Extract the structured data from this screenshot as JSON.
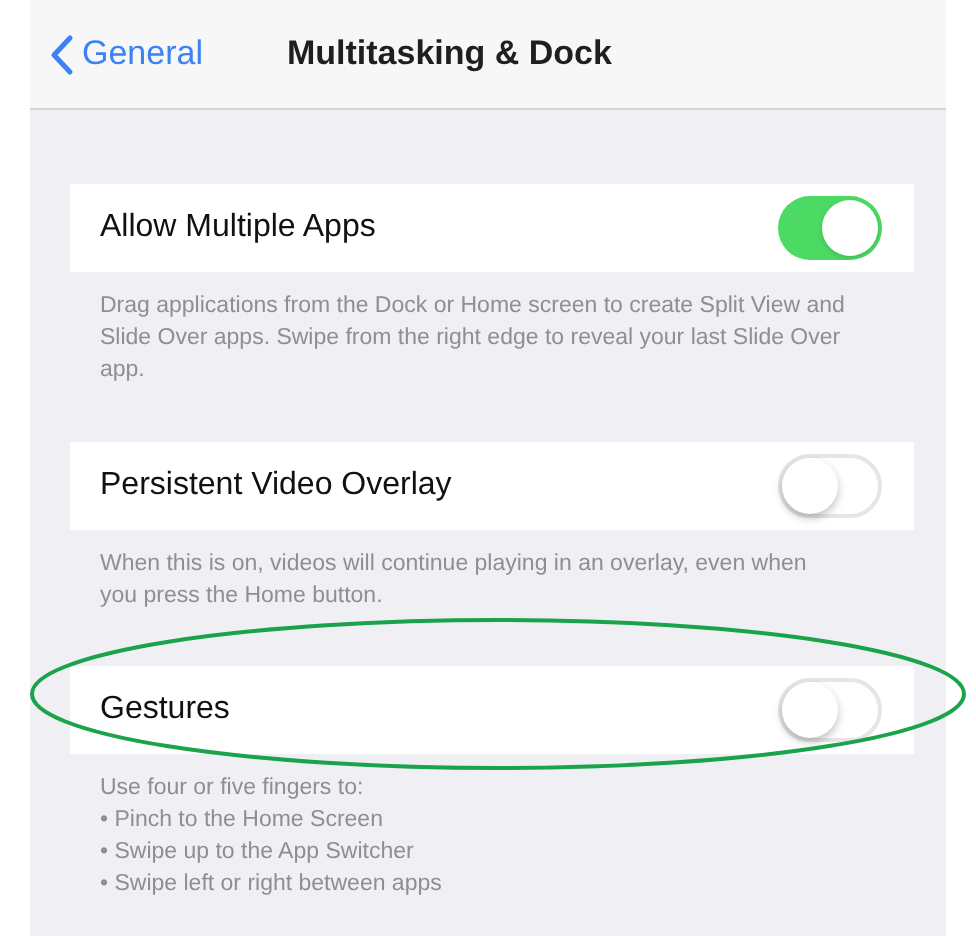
{
  "nav": {
    "back": "General",
    "title": "Multitasking & Dock"
  },
  "sections": [
    {
      "label": "Allow Multiple Apps",
      "on": true,
      "footer": [
        "Drag applications from the Dock or Home screen to create Split View and Slide Over apps. Swipe from the right edge to reveal your last Slide Over app."
      ]
    },
    {
      "label": "Persistent Video Overlay",
      "on": false,
      "footer": [
        "When this is on, videos will continue playing in an overlay, even when you press the Home button."
      ]
    },
    {
      "label": "Gestures",
      "on": false,
      "footer": [
        "Use four or five fingers to:",
        "• Pinch to the Home Screen",
        "• Swipe up to the App Switcher",
        "• Swipe left or right between apps"
      ]
    }
  ]
}
